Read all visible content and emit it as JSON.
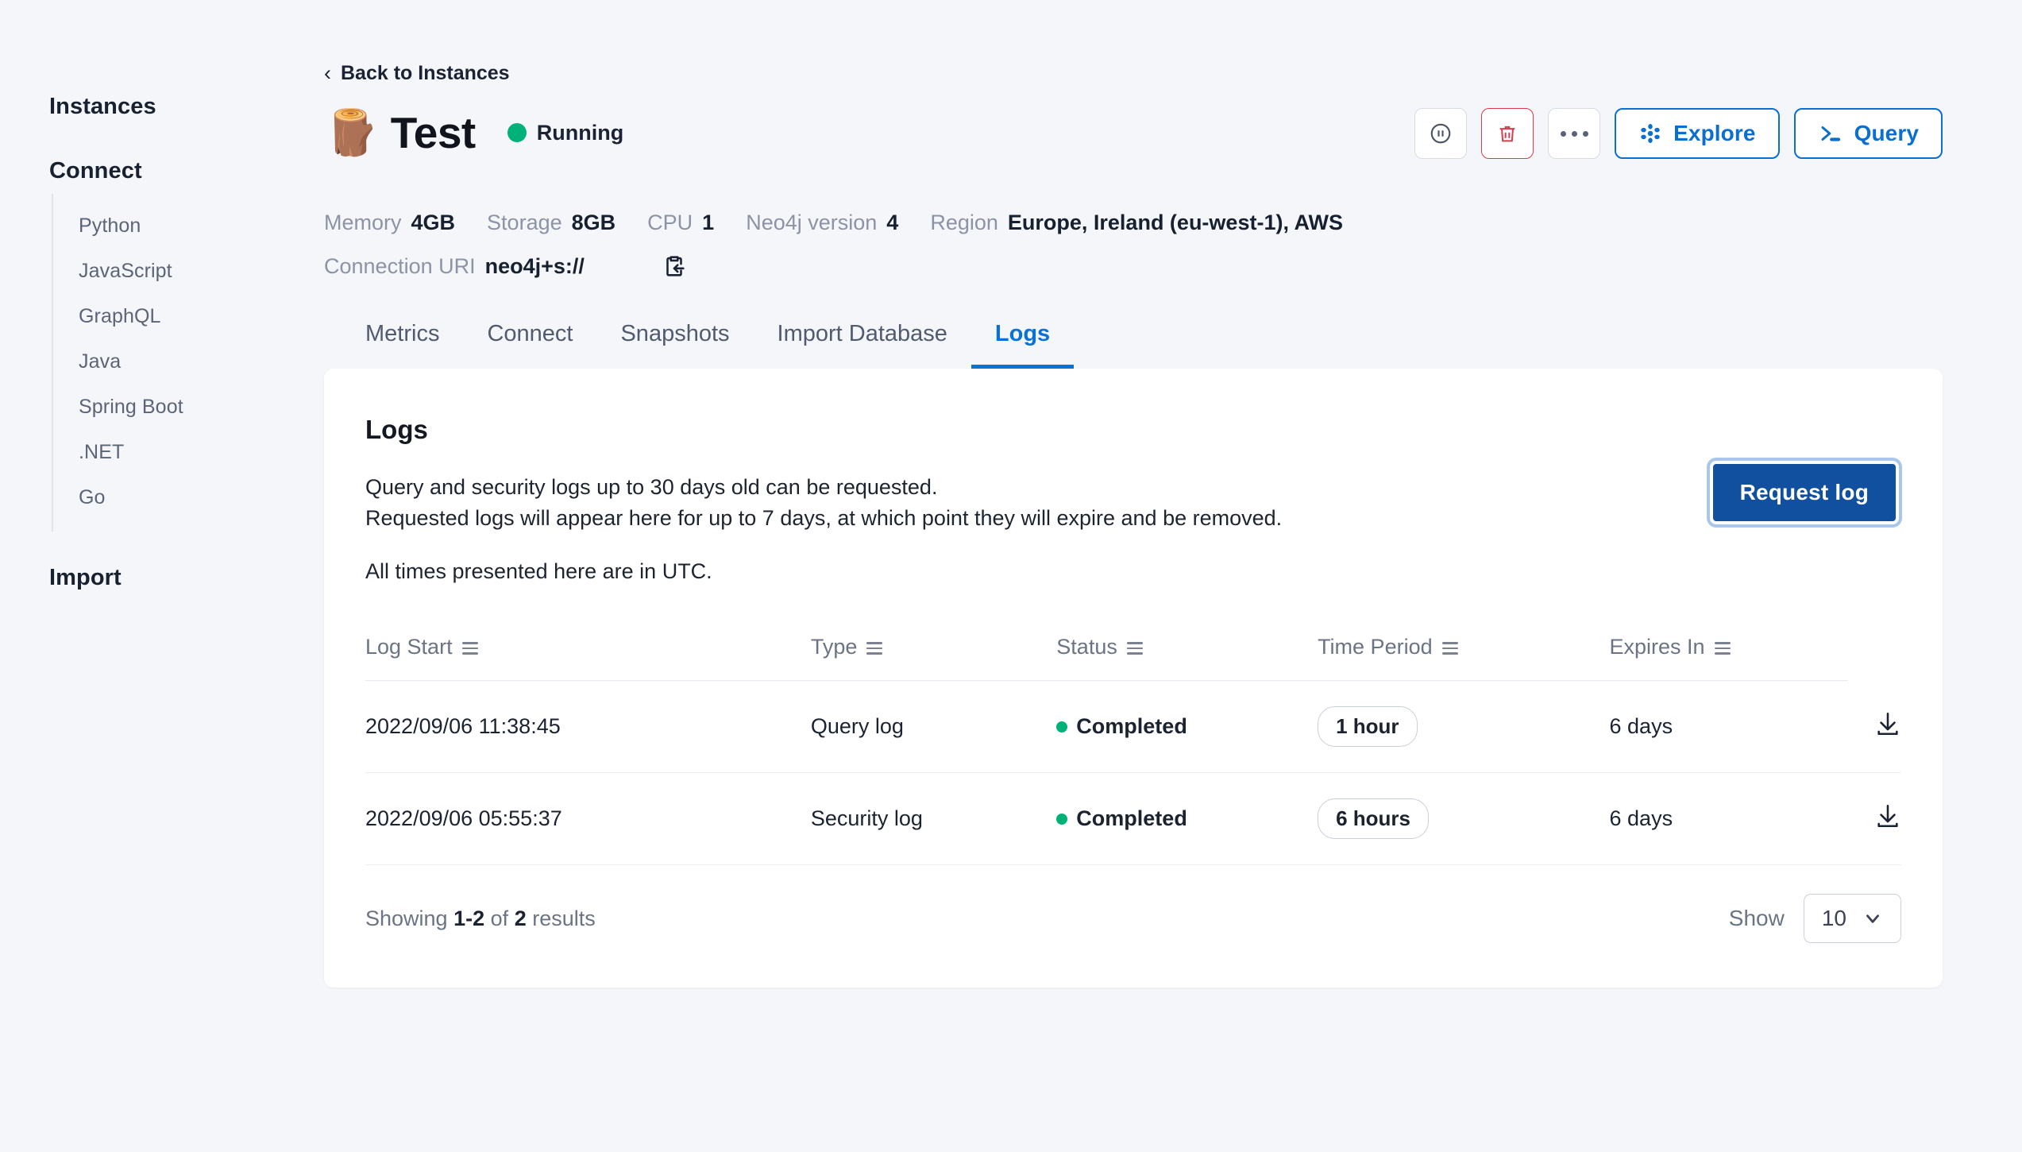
{
  "sidebar": {
    "instances_label": "Instances",
    "connect_label": "Connect",
    "import_label": "Import",
    "connect_items": [
      {
        "label": "Python"
      },
      {
        "label": "JavaScript"
      },
      {
        "label": "GraphQL"
      },
      {
        "label": "Java"
      },
      {
        "label": "Spring Boot"
      },
      {
        "label": ".NET"
      },
      {
        "label": "Go"
      }
    ]
  },
  "header": {
    "back_label": "Back to Instances",
    "back_chevron": "‹",
    "instance_emoji": "🪵",
    "instance_name": "Test",
    "status_label": "Running",
    "status_color": "#00b277"
  },
  "actions": {
    "pause_title": "Pause",
    "delete_title": "Delete",
    "more_title": "More options",
    "explore_label": "Explore",
    "query_label": "Query",
    "accent_color": "#0a6fd1",
    "danger_color": "#d93b4e"
  },
  "meta": {
    "items": [
      {
        "key": "Memory",
        "value": "4GB"
      },
      {
        "key": "Storage",
        "value": "8GB"
      },
      {
        "key": "CPU",
        "value": "1"
      },
      {
        "key": "Neo4j version",
        "value": "4"
      },
      {
        "key": "Region",
        "value": "Europe, Ireland (eu-west-1), AWS"
      }
    ],
    "uri_key": "Connection URI",
    "uri_value": "neo4j+s://"
  },
  "tabs": [
    {
      "label": "Metrics",
      "active": false
    },
    {
      "label": "Connect",
      "active": false
    },
    {
      "label": "Snapshots",
      "active": false
    },
    {
      "label": "Import Database",
      "active": false
    },
    {
      "label": "Logs",
      "active": true
    }
  ],
  "card": {
    "title": "Logs",
    "desc_line1": "Query and security logs up to 30 days old can be requested.",
    "desc_line2": "Requested logs will appear here for up to 7 days, at which point they will expire and be removed.",
    "desc_line3": "All times presented here are in UTC.",
    "request_button": "Request log",
    "request_button_color": "#11509e"
  },
  "table": {
    "columns": [
      {
        "label": "Log Start"
      },
      {
        "label": "Type"
      },
      {
        "label": "Status"
      },
      {
        "label": "Time Period"
      },
      {
        "label": "Expires In"
      }
    ],
    "rows": [
      {
        "log_start": "2022/09/06 11:38:45",
        "type": "Query log",
        "status": "Completed",
        "time_period": "1 hour",
        "expires_in": "6 days"
      },
      {
        "log_start": "2022/09/06 05:55:37",
        "type": "Security log",
        "status": "Completed",
        "time_period": "6 hours",
        "expires_in": "6 days"
      }
    ]
  },
  "footer": {
    "showing_prefix": "Showing",
    "showing_range": "1-2",
    "showing_mid": "of",
    "showing_total": "2",
    "showing_suffix": "results",
    "show_label": "Show",
    "page_size": "10"
  }
}
